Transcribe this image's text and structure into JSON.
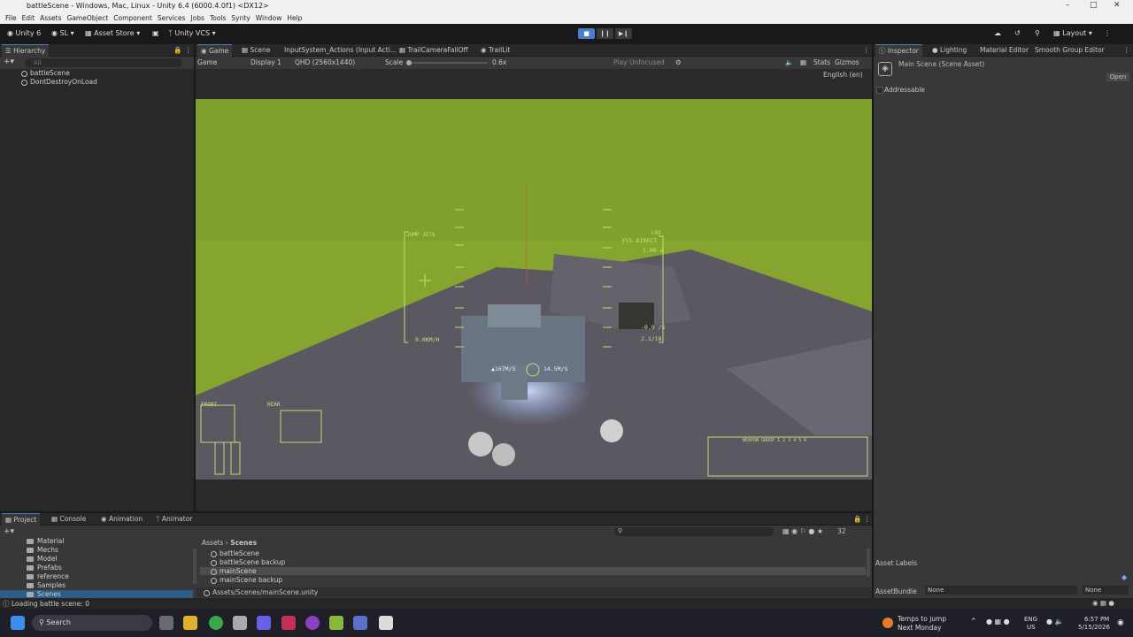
{
  "window": {
    "title": "battleScene - Windows, Mac, Linux - Unity 6.4 (6000.4.0f1) <DX12>"
  },
  "menu": [
    "File",
    "Edit",
    "Assets",
    "GameObject",
    "Component",
    "Services",
    "Jobs",
    "Tools",
    "Synty",
    "Window",
    "Help"
  ],
  "toolbar": {
    "unity": "Unity 6",
    "account": "SL",
    "asset_store": "Asset Store",
    "vcs": "Unity VCS",
    "layout": "Layout"
  },
  "hierarchy": {
    "tab": "Hierarchy",
    "search": "All",
    "items": [
      "battleScene",
      "DontDestroyOnLoad"
    ]
  },
  "game_tabs": [
    "Game",
    "Scene",
    "InputSystem_Actions (Input Acti...",
    "TrailCameraFallOff",
    "TrailLit"
  ],
  "game_toolbar": {
    "mode": "Game",
    "display": "Display 1",
    "resolution": "QHD (2560x1440)",
    "scale_label": "Scale",
    "scale_value": "0.6x",
    "play_focus": "Play Unfocused",
    "stats": "Stats",
    "gizmos": "Gizmos",
    "language": "English (en)"
  },
  "hud": {
    "jump_jets": "JUMP JETS",
    "speed": "0.0KM/H",
    "fcs": "FCS DIRECT",
    "fcs_value": "1.00 x",
    "las": "LAS",
    "vertical_rate": "-0.9 /S",
    "counter": "2.1/18",
    "speed_left": "167M/S",
    "speed_right": "14.5M/S",
    "front": "FRONT",
    "rear": "REAR",
    "weapon_group": "WEAPON GROUP 1 2 3 4 5 6"
  },
  "inspector": {
    "tabs": [
      "Inspector",
      "Lighting",
      "Material Editor",
      "Smooth Group Editor"
    ],
    "asset_title": "Main Scene (Scene Asset)",
    "open_button": "Open",
    "addressable": "Addressable",
    "asset_labels": "Asset Labels",
    "asset_bundle_label": "AssetBundle",
    "asset_bundle_value": "None",
    "variant_value": "None"
  },
  "bottom_tabs": [
    "Project",
    "Console",
    "Animation",
    "Animator"
  ],
  "project": {
    "folders": [
      "Material",
      "Mechs",
      "Model",
      "Prefabs",
      "reference",
      "Samples",
      "Scenes"
    ],
    "breadcrumb": [
      "Assets",
      "Scenes"
    ],
    "assets": [
      "battleScene",
      "battleScene backup",
      "mainScene",
      "mainScene backup"
    ],
    "selected_path": "Assets/Scenes/mainScene.unity",
    "count": "32"
  },
  "status": "Loading battle scene: 0",
  "taskbar": {
    "search": "Search",
    "weather_title": "Temps to jump",
    "weather_sub": "Next Monday",
    "lang1": "ENG",
    "lang2": "US",
    "time": "6:57 PM",
    "date": "5/15/2026"
  }
}
